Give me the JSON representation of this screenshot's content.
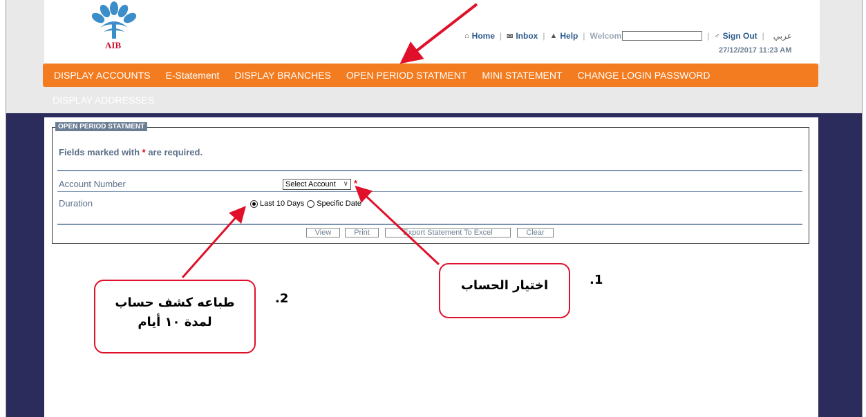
{
  "brand": {
    "logo_text": "AIB",
    "logo_color": "#c8102e",
    "logo_petal_color": "#3b8ec9"
  },
  "toplinks": {
    "home": "Home",
    "inbox": "Inbox",
    "help": "Help",
    "welcome": "Welcom",
    "sign_out": "Sign Out",
    "language": "عربي",
    "datetime": "27/12/2017 11:23 AM",
    "icons": {
      "home": "home-icon",
      "inbox": "envelope-icon",
      "help": "warning-icon",
      "sign_out": "lock-icon"
    }
  },
  "nav": {
    "items": [
      {
        "label": "DISPLAY ACCOUNTS"
      },
      {
        "label": "E-Statement"
      },
      {
        "label": "DISPLAY BRANCHES"
      },
      {
        "label": "OPEN PERIOD STATMENT"
      },
      {
        "label": "MINI STATEMENT"
      },
      {
        "label": "CHANGE LOGIN PASSWORD"
      }
    ],
    "second_row": "DISPLAY ADDRESSES",
    "color": "#f47c20"
  },
  "form": {
    "legend": "OPEN PERIOD STATMENT",
    "required_note_prefix": "Fields marked with ",
    "required_star": "*",
    "required_note_suffix": " are required.",
    "account_label": "Account Number",
    "account_select": "Select Account",
    "duration_label": "Duration",
    "duration_options": [
      "Last 10 Days",
      "Specific Date"
    ],
    "duration_selected": "Last 10 Days",
    "buttons": {
      "view": "View",
      "print": "Print",
      "export": "Export Statement To Excel",
      "clear": "Clear"
    }
  },
  "annotations": {
    "step1": {
      "number": ".1",
      "text": "اختيار الحساب"
    },
    "step2": {
      "number": ".2",
      "line1": "طباعه كشف حساب",
      "line2": "لمدة ١٠ أيام"
    },
    "color": "#e0102a"
  },
  "colors": {
    "header_bg": "#e9e9e9",
    "dark_band": "#2b2b5c",
    "label_text": "#5b6f88"
  }
}
